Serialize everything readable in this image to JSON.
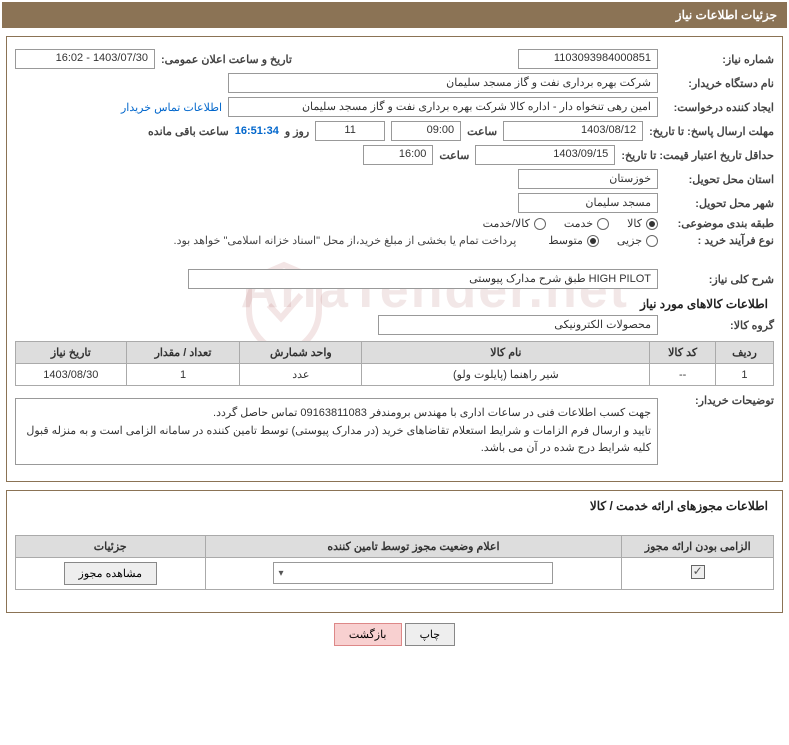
{
  "header": {
    "title": "جزئیات اطلاعات نیاز"
  },
  "fields": {
    "need_number_label": "شماره نیاز:",
    "need_number": "1103093984000851",
    "announce_label": "تاریخ و ساعت اعلان عمومی:",
    "announce_value": "1403/07/30 - 16:02",
    "buyer_org_label": "نام دستگاه خریدار:",
    "buyer_org": "شرکت بهره برداری نفت و گاز مسجد سلیمان",
    "requester_label": "ایجاد کننده درخواست:",
    "requester": "امین رهی تنخواه دار - اداره کالا   شرکت بهره برداری نفت و گاز مسجد سلیمان",
    "contact_link": "اطلاعات تماس خریدار",
    "deadline_label": "مهلت ارسال پاسخ: تا تاریخ:",
    "deadline_date": "1403/08/12",
    "time_label": "ساعت",
    "deadline_time": "09:00",
    "days_value": "11",
    "days_label": "روز و",
    "remaining_time": "16:51:34",
    "remaining_label": "ساعت باقی مانده",
    "validity_label": "حداقل تاریخ اعتبار قیمت: تا تاریخ:",
    "validity_date": "1403/09/15",
    "validity_time": "16:00",
    "province_label": "استان محل تحویل:",
    "province": "خوزستان",
    "city_label": "شهر محل تحویل:",
    "city": "مسجد سلیمان",
    "category_label": "طبقه بندی موضوعی:",
    "cat_goods": "کالا",
    "cat_service": "خدمت",
    "cat_goods_service": "کالا/خدمت",
    "process_label": "نوع فرآیند خرید :",
    "proc_partial": "جزیی",
    "proc_medium": "متوسط",
    "payment_note": "پرداخت تمام یا بخشی از مبلغ خرید،از محل \"اسناد خزانه اسلامی\" خواهد بود.",
    "desc_label": "شرح کلی نیاز:",
    "desc_value": "HIGH PILOT طبق شرح مدارک پیوستی",
    "goods_info_title": "اطلاعات کالاهای مورد نیاز",
    "group_label": "گروه کالا:",
    "group_value": "محصولات الکترونیکی",
    "buyer_notes_label": "توضیحات خریدار:",
    "buyer_notes_l1": "جهت کسب اطلاعات فنی در ساعات اداری با مهندس برومندفر  09163811083  تماس حاصل گردد.",
    "buyer_notes_l2": "تایید و ارسال فرم الزامات و شرایط استعلام تقاضاهای خرید (در مدارک پیوستی) توسط تامین کننده در سامانه الزامی است و به منزله قبول کلیه شرایط درج شده در آن می باشد.",
    "permits_title": "اطلاعات مجوزهای ارائه خدمت / کالا"
  },
  "table": {
    "h_row": "ردیف",
    "h_code": "کد کالا",
    "h_name": "نام کالا",
    "h_unit": "واحد شمارش",
    "h_qty": "تعداد / مقدار",
    "h_date": "تاریخ نیاز",
    "rows": [
      {
        "row": "1",
        "code": "--",
        "name": "شیر راهنما (پایلوت ولو)",
        "unit": "عدد",
        "qty": "1",
        "date": "1403/08/30"
      }
    ]
  },
  "permits_table": {
    "h_mandatory": "الزامی بودن ارائه مجوز",
    "h_status": "اعلام وضعیت مجوز توسط تامین کننده",
    "h_details": "جزئیات",
    "view_btn": "مشاهده مجوز"
  },
  "buttons": {
    "print": "چاپ",
    "back": "بازگشت"
  },
  "watermark": "AriaTender.net"
}
